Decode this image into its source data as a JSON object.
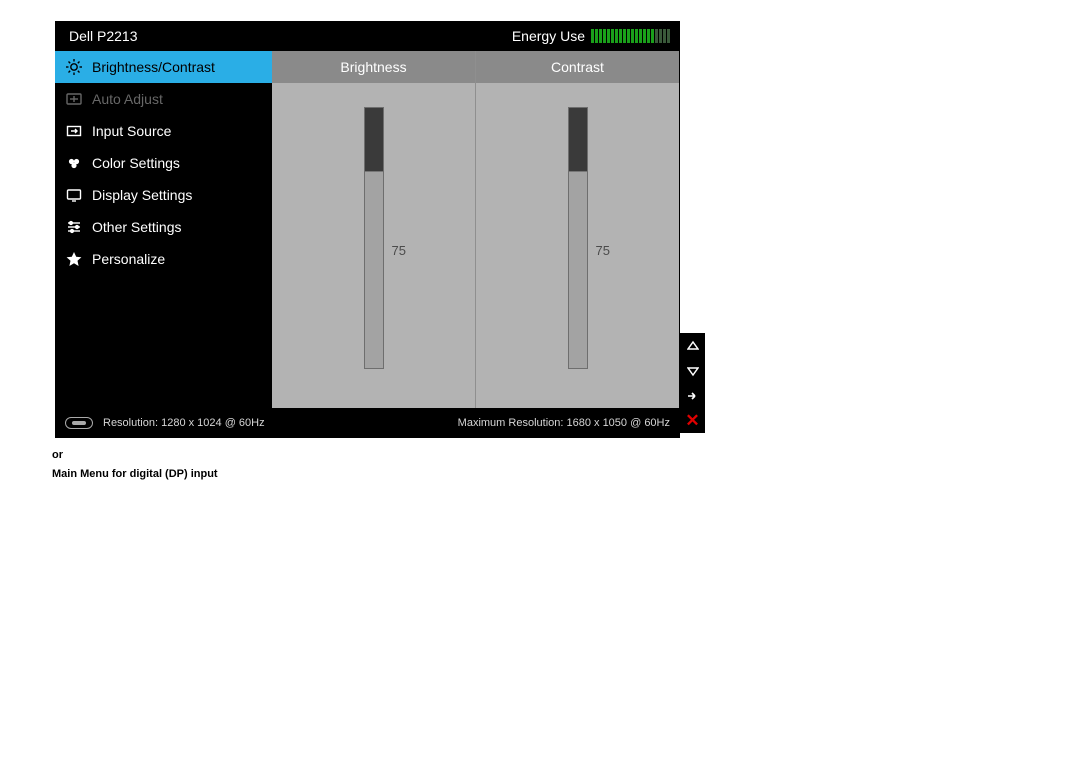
{
  "header": {
    "model": "Dell P2213",
    "energy_label": "Energy Use",
    "energy_segments": 20,
    "energy_lit": 16
  },
  "sidebar": {
    "items": [
      {
        "label": "Brightness/Contrast",
        "icon": "brightness-icon",
        "state": "selected"
      },
      {
        "label": "Auto Adjust",
        "icon": "auto-adjust-icon",
        "state": "disabled"
      },
      {
        "label": "Input Source",
        "icon": "input-source-icon",
        "state": "normal"
      },
      {
        "label": "Color Settings",
        "icon": "color-settings-icon",
        "state": "normal"
      },
      {
        "label": "Display Settings",
        "icon": "display-settings-icon",
        "state": "normal"
      },
      {
        "label": "Other Settings",
        "icon": "other-settings-icon",
        "state": "normal"
      },
      {
        "label": "Personalize",
        "icon": "personalize-icon",
        "state": "normal"
      }
    ]
  },
  "panes": {
    "brightness": {
      "label": "Brightness",
      "value": 75,
      "max": 100
    },
    "contrast": {
      "label": "Contrast",
      "value": 75,
      "max": 100
    }
  },
  "footer": {
    "resolution_label": "Resolution: 1280 x 1024 @ 60Hz",
    "max_resolution_label": "Maximum Resolution: 1680 x 1050 @ 60Hz"
  },
  "nav": {
    "up": "up-arrow-icon",
    "down": "down-arrow-icon",
    "enter": "right-arrow-icon",
    "close": "close-icon"
  },
  "captions": {
    "or": "or",
    "subtitle": "Main Menu for digital (DP) input"
  }
}
